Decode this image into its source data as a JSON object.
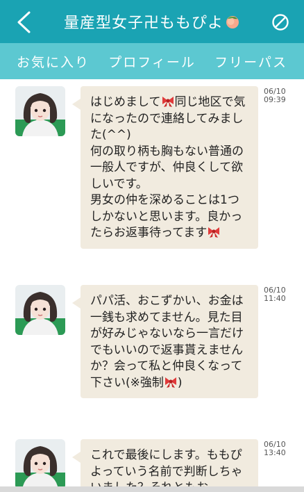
{
  "header": {
    "title": "量産型女子卍ももぴよ",
    "title_emoji": "peach"
  },
  "subnav": {
    "favorite": "お気に入り",
    "profile": "プロフィール",
    "free_pass": "フリーパス"
  },
  "messages": [
    {
      "date": "06/10",
      "time": "09:39",
      "lines": [
        "はじめまして{ribbon}同じ地区で気になったので連絡してみました(^^)",
        "何の取り柄も胸もない普通の一般人ですが、仲良くして欲しいです。",
        "男女の仲を深めることは1つしかないと思います。良かったらお返事待ってます{ribbon}"
      ]
    },
    {
      "date": "06/10",
      "time": "11:40",
      "lines": [
        "パパ活、おこずかい、お金は一銭も求めてません。見た目が好みじゃないなら一言だけでもいいので返事貰えませんか？会って私と仲良くなって下さい(※強制{ribbon})"
      ]
    },
    {
      "date": "06/10",
      "time": "13:40",
      "lines": [
        "これで最後にします。ももぴよっていう名前で判断しちゃいました？それともお"
      ]
    }
  ],
  "colors": {
    "header_bg": "#1aa3b3",
    "subnav_bg": "#5cc8d1",
    "bubble_bg": "#f1ebdf"
  }
}
